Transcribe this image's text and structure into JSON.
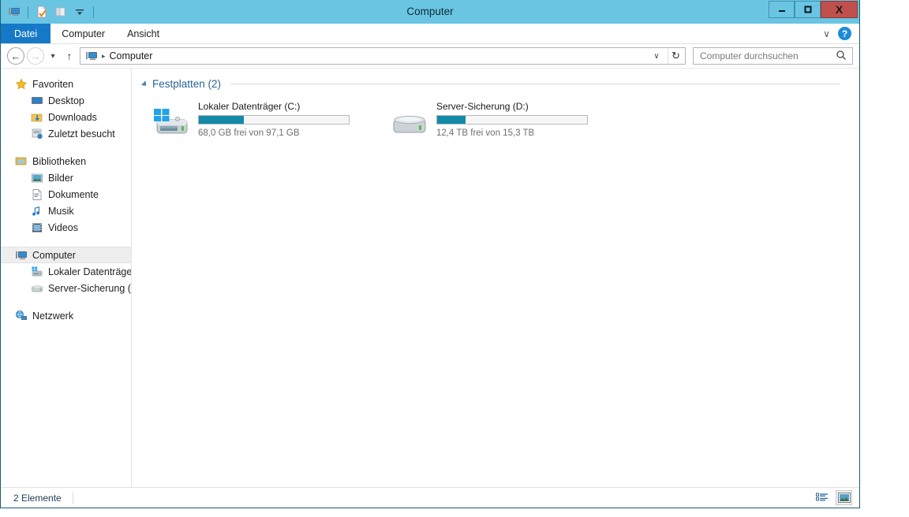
{
  "window": {
    "title": "Computer",
    "quick_access": [
      {
        "name": "computer-icon",
        "label": "Computer"
      },
      {
        "name": "properties-icon",
        "label": "Eigenschaften"
      },
      {
        "name": "new-folder-icon",
        "label": "Neuer Ordner"
      },
      {
        "name": "customize-qat-icon",
        "label": "Symbolleiste anpassen"
      }
    ],
    "controls": {
      "minimize": "—",
      "maximize": "☐",
      "close": "X"
    }
  },
  "ribbon": {
    "tabs": [
      {
        "label": "Datei",
        "active": true
      },
      {
        "label": "Computer",
        "active": false
      },
      {
        "label": "Ansicht",
        "active": false
      }
    ],
    "expand_icon": "∨",
    "help_label": "?"
  },
  "navbar": {
    "back_icon": "←",
    "forward_icon": "→",
    "history_icon": "▾",
    "up_icon": "↑",
    "breadcrumb": {
      "icon": "computer-icon",
      "separator": "▸",
      "path": "Computer"
    },
    "address_caret": "∨",
    "refresh_icon": "↻"
  },
  "search": {
    "placeholder": "Computer durchsuchen",
    "value": "",
    "icon": "search-icon"
  },
  "sidebar": {
    "groups": [
      {
        "root": {
          "label": "Favoriten",
          "icon": "star-icon"
        },
        "items": [
          {
            "label": "Desktop",
            "icon": "desktop-icon"
          },
          {
            "label": "Downloads",
            "icon": "downloads-icon"
          },
          {
            "label": "Zuletzt besucht",
            "icon": "recent-icon"
          }
        ]
      },
      {
        "root": {
          "label": "Bibliotheken",
          "icon": "libraries-icon"
        },
        "items": [
          {
            "label": "Bilder",
            "icon": "pictures-icon"
          },
          {
            "label": "Dokumente",
            "icon": "documents-icon"
          },
          {
            "label": "Musik",
            "icon": "music-icon"
          },
          {
            "label": "Videos",
            "icon": "videos-icon"
          }
        ]
      },
      {
        "root": {
          "label": "Computer",
          "icon": "computer-icon",
          "selected": true
        },
        "items": [
          {
            "label": "Lokaler Datenträger",
            "icon": "harddisk-icon"
          },
          {
            "label": "Server-Sicherung (D",
            "icon": "harddisk-icon"
          }
        ]
      },
      {
        "root": {
          "label": "Netzwerk",
          "icon": "network-icon"
        },
        "items": []
      }
    ]
  },
  "content": {
    "group": {
      "title": "Festplatten (2)",
      "collapse_icon": "triangle-down-icon"
    },
    "drives": [
      {
        "label": "Lokaler Datenträger (C:)",
        "free_text": "68,0 GB frei von 97,1 GB",
        "used_percent": 30,
        "icon": "windows-drive-icon",
        "free": "68,0 GB",
        "total": "97,1 GB"
      },
      {
        "label": "Server-Sicherung (D:)",
        "free_text": "12,4 TB frei von 15,3 TB",
        "used_percent": 19,
        "icon": "harddisk-icon",
        "free": "12,4 TB",
        "total": "15,3 TB"
      }
    ]
  },
  "statusbar": {
    "item_count": "2 Elemente",
    "views": [
      {
        "name": "details-view-button",
        "active": false
      },
      {
        "name": "large-icons-view-button",
        "active": true
      }
    ]
  },
  "colors": {
    "title_bar": "#6ac5e3",
    "file_tab": "#1679c8",
    "accent_bar": "#128aa8",
    "group_title": "#2a6496",
    "close_button": "#c0504d"
  }
}
